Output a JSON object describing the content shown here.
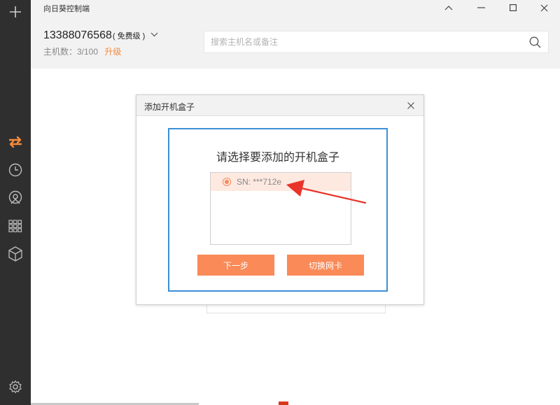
{
  "app": {
    "title": "向日葵控制端"
  },
  "sidebar": {
    "items": [
      {
        "icon": "plus-icon"
      },
      {
        "icon": "remote-control-icon",
        "active": true
      },
      {
        "icon": "clock-icon"
      },
      {
        "icon": "discover-icon"
      },
      {
        "icon": "apps-grid-icon"
      },
      {
        "icon": "cube-icon"
      },
      {
        "icon": "gear-icon"
      }
    ],
    "active_color": "#f58a3c"
  },
  "account": {
    "phone": "13388076568",
    "tier": "( 免费级 )",
    "machine_count_label": "主机数：3/100",
    "upgrade_label": "升级"
  },
  "search": {
    "placeholder": "搜索主机名或备注",
    "value": ""
  },
  "dialog": {
    "title": "添加开机盒子",
    "heading": "请选择要添加的开机盒子",
    "items": [
      {
        "label": "SN: ***712e",
        "selected": true
      }
    ],
    "next_label": "下一步",
    "switch_label": "切换网卡"
  },
  "colors": {
    "accent": "#fa8a57",
    "highlight_frame": "#3d8fd6",
    "annotation_arrow": "#e8342a"
  }
}
